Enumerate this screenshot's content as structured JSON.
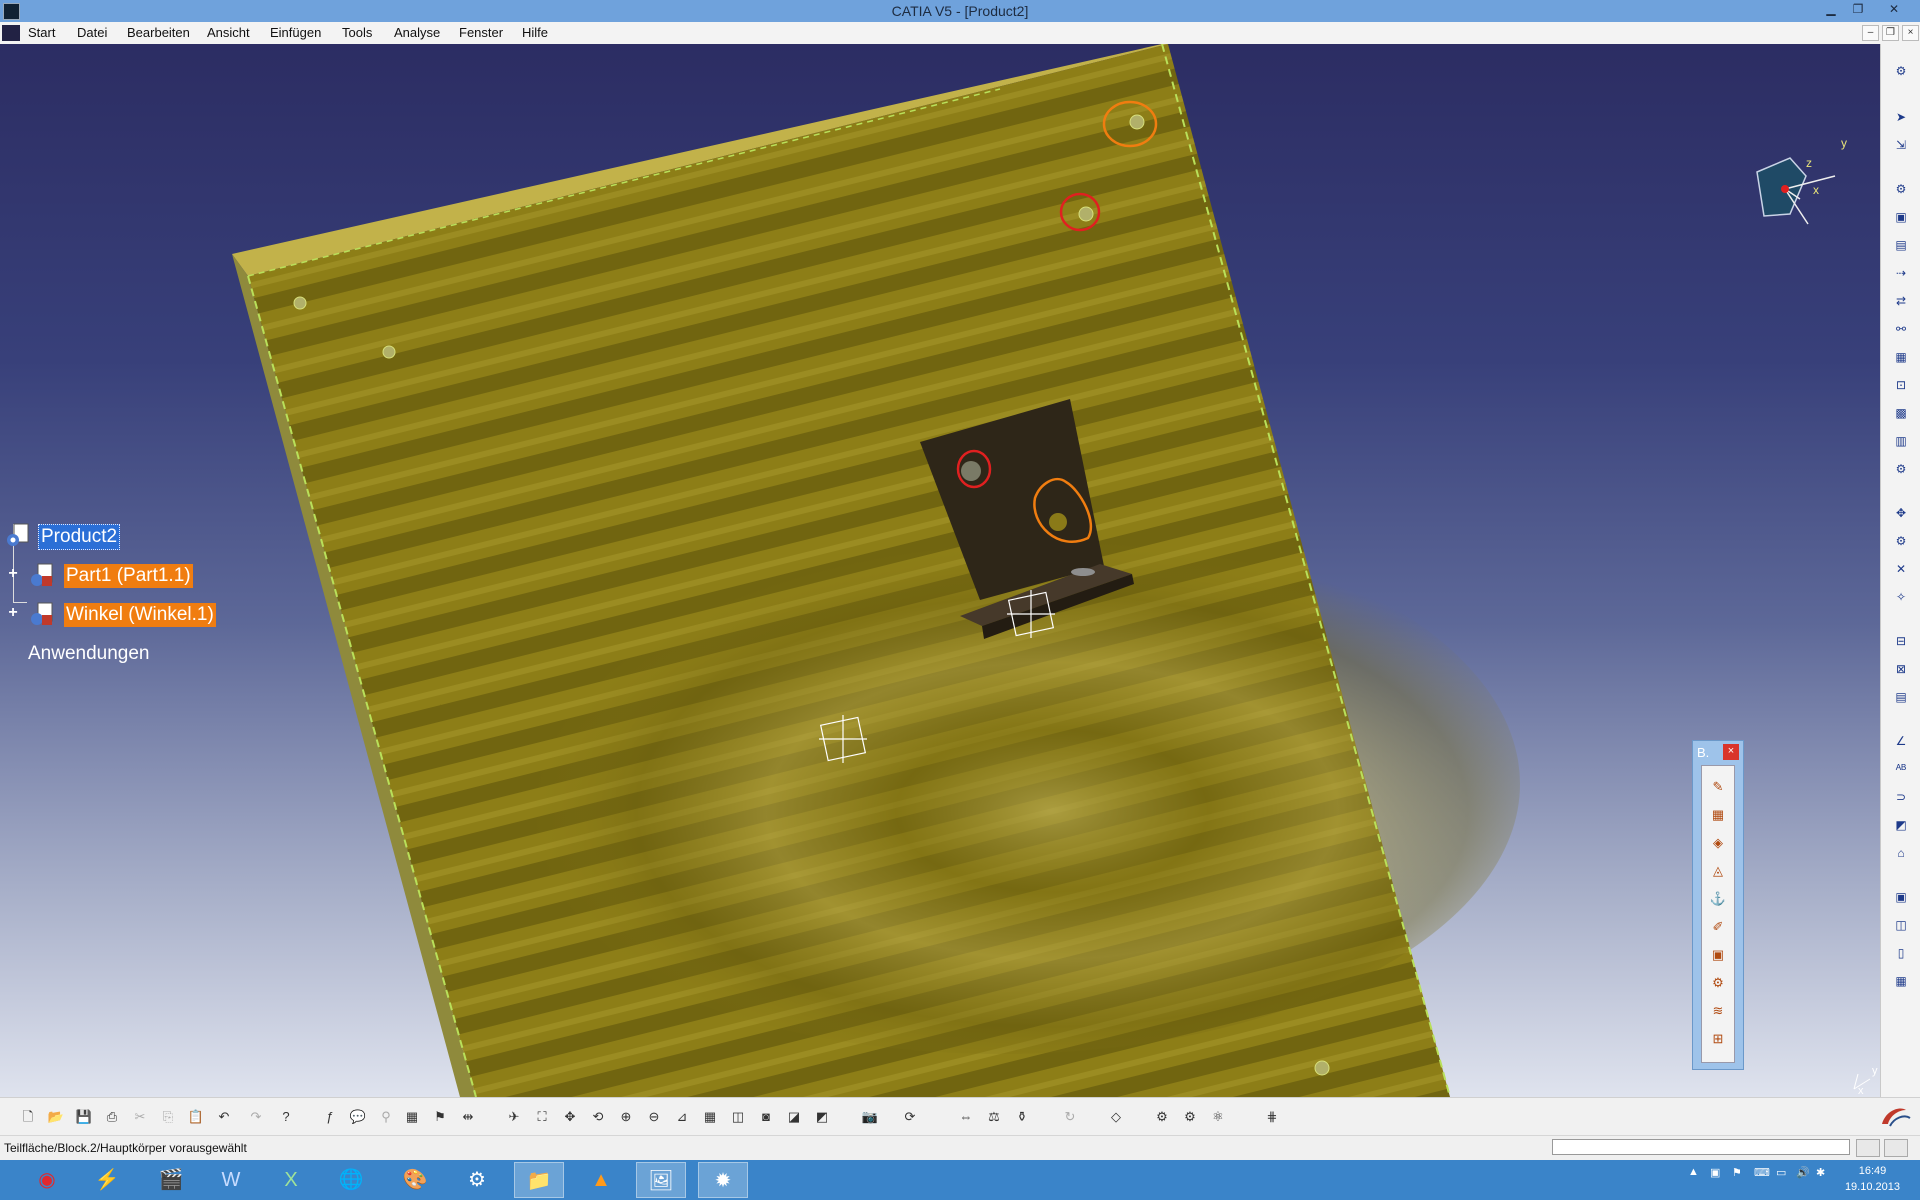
{
  "window": {
    "title": "CATIA V5 - [Product2]"
  },
  "menu": {
    "items": [
      "Start",
      "Datei",
      "Bearbeiten",
      "Ansicht",
      "Einfügen",
      "Tools",
      "Analyse",
      "Fenster",
      "Hilfe"
    ]
  },
  "tree": {
    "root": "Product2",
    "children": [
      {
        "label": "Part1 (Part1.1)"
      },
      {
        "label": "Winkel (Winkel.1)"
      }
    ],
    "applications": "Anwendungen"
  },
  "compass": {
    "y_label": "y",
    "z_label": "z",
    "x_label": "x"
  },
  "mini_axis": {
    "y_label": "y",
    "x_label": "x"
  },
  "floating_toolbar": {
    "title": "B.",
    "close": "×"
  },
  "status": {
    "text": "Teilfläche/Block.2/Hauptkörper vorausgewählt",
    "input_value": ""
  },
  "taskbar": {
    "time": "16:49",
    "date": "19.10.2013"
  },
  "colors": {
    "board": "#8a7a18",
    "selection": "#2b6fd6",
    "tree_highlight": "#f07d10",
    "taskbar": "#3a84c9",
    "annotation_orange": "#f07d10",
    "annotation_red": "#e02020"
  }
}
